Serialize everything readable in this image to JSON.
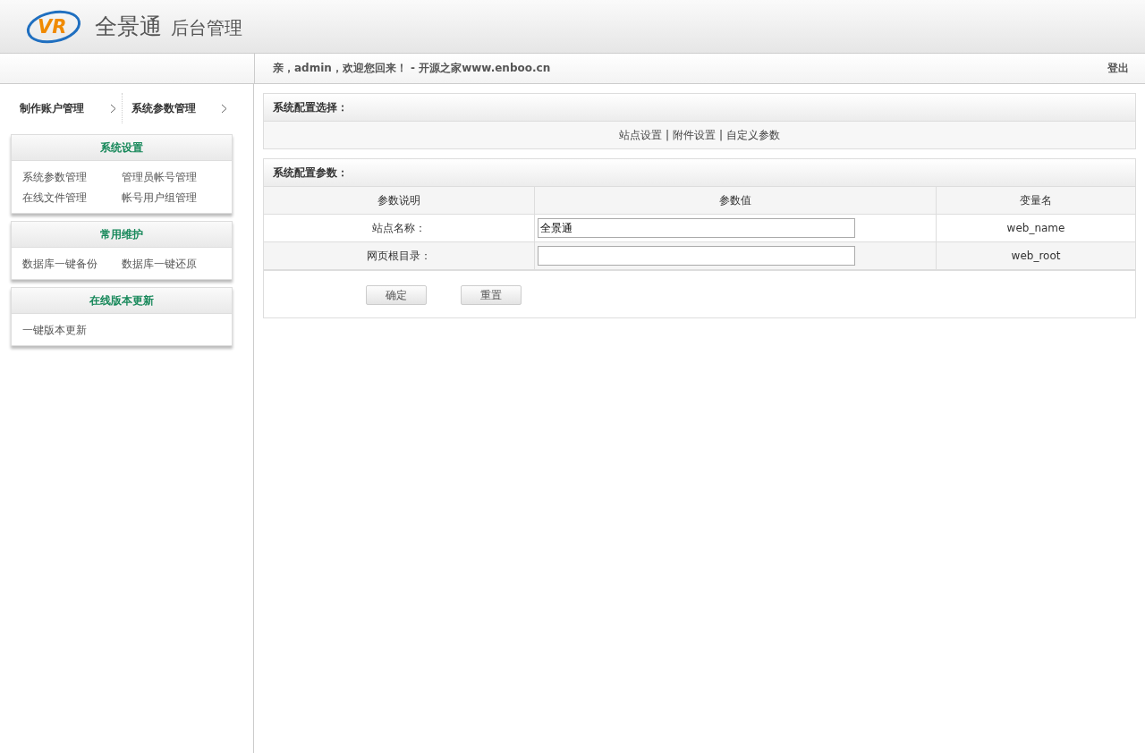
{
  "header": {
    "logo_text": "VR",
    "title": "全景通",
    "subtitle": "后台管理"
  },
  "topbar": {
    "welcome": "亲，admin，欢迎您回来！ - 开源之家www.enboo.cn",
    "logout": "登出"
  },
  "breadcrumb": [
    "制作账户管理",
    "系统参数管理"
  ],
  "sidebar": {
    "groups": [
      {
        "title": "系统设置",
        "items": [
          "系统参数管理",
          "管理员帐号管理",
          "在线文件管理",
          "帐号用户组管理"
        ]
      },
      {
        "title": "常用维护",
        "items": [
          "数据库一键备份",
          "数据库一键还原"
        ]
      },
      {
        "title": "在线版本更新",
        "items": [
          "一键版本更新"
        ]
      }
    ]
  },
  "select_panel": {
    "title": "系统配置选择：",
    "links": [
      "站点设置",
      "附件设置",
      "自定义参数"
    ],
    "separator": "|"
  },
  "params_panel": {
    "title": "系统配置参数：",
    "columns": [
      "参数说明",
      "参数值",
      "变量名"
    ],
    "rows": [
      {
        "label": "站点名称：",
        "value": "全景通",
        "var": "web_name"
      },
      {
        "label": "网页根目录：",
        "value": "",
        "var": "web_root"
      }
    ],
    "buttons": [
      "确定",
      "重置"
    ]
  }
}
